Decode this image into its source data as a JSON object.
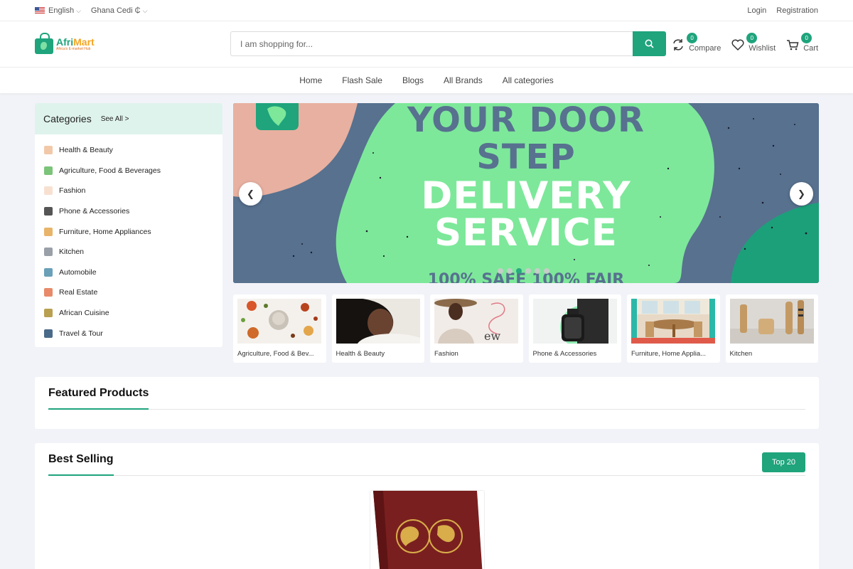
{
  "topbar": {
    "language": "English",
    "currency": "Ghana Cedi ₵",
    "login": "Login",
    "registration": "Registration"
  },
  "logo": {
    "name_part1": "Afri",
    "name_part2": "Mart",
    "tagline": "Africa's E-market Hub"
  },
  "search": {
    "placeholder": "I am shopping for..."
  },
  "header_actions": [
    {
      "label": "Compare",
      "count": "0",
      "icon": "compare-icon"
    },
    {
      "label": "Wishlist",
      "count": "0",
      "icon": "heart-icon"
    },
    {
      "label": "Cart",
      "count": "0",
      "icon": "cart-icon"
    }
  ],
  "nav": [
    "Home",
    "Flash Sale",
    "Blogs",
    "All Brands",
    "All categories"
  ],
  "categories": {
    "title": "Categories",
    "see_all": "See All >",
    "items": [
      {
        "label": "Health & Beauty",
        "icon": "health-beauty-icon",
        "color": "#f2c9a8"
      },
      {
        "label": "Agriculture, Food & Beverages",
        "icon": "agriculture-icon",
        "color": "#7cc47a"
      },
      {
        "label": "Fashion",
        "icon": "fashion-icon",
        "color": "#f8e0d0"
      },
      {
        "label": "Phone & Accessories",
        "icon": "phone-icon",
        "color": "#555555"
      },
      {
        "label": "Furniture, Home Appliances",
        "icon": "furniture-icon",
        "color": "#e8b46a"
      },
      {
        "label": "Kitchen",
        "icon": "kitchen-icon",
        "color": "#9aa0a8"
      },
      {
        "label": "Automobile",
        "icon": "car-icon",
        "color": "#6aa0b8"
      },
      {
        "label": "Real Estate",
        "icon": "house-icon",
        "color": "#e88a6a"
      },
      {
        "label": "African Cuisine",
        "icon": "cuisine-icon",
        "color": "#b8a050"
      },
      {
        "label": "Travel & Tour",
        "icon": "plane-icon",
        "color": "#4a6a8a"
      }
    ]
  },
  "banner": {
    "line1": "YOUR DOOR",
    "line2": "STEP",
    "line3": "DELIVERY",
    "line4": "SERVICE",
    "line5": "100% SAFE 100% FAIR",
    "slide_count": 6,
    "active_slide": 3
  },
  "category_cards": [
    {
      "label": "Agriculture, Food & Bev...",
      "image": "spices-image"
    },
    {
      "label": "Health & Beauty",
      "image": "woman-portrait-image"
    },
    {
      "label": "Fashion",
      "image": "fashion-model-image"
    },
    {
      "label": "Phone & Accessories",
      "image": "smartwatch-image"
    },
    {
      "label": "Furniture, Home Applia...",
      "image": "dining-room-image"
    },
    {
      "label": "Kitchen",
      "image": "kitchen-utensils-image"
    }
  ],
  "featured": {
    "title": "Featured Products"
  },
  "best_selling": {
    "title": "Best Selling",
    "button": "Top 20",
    "product_image": "passport-image"
  },
  "colors": {
    "accent": "#1fa47c",
    "banner_green": "#7de89a",
    "banner_blue": "#57718f",
    "banner_pink": "#e8b0a0"
  }
}
